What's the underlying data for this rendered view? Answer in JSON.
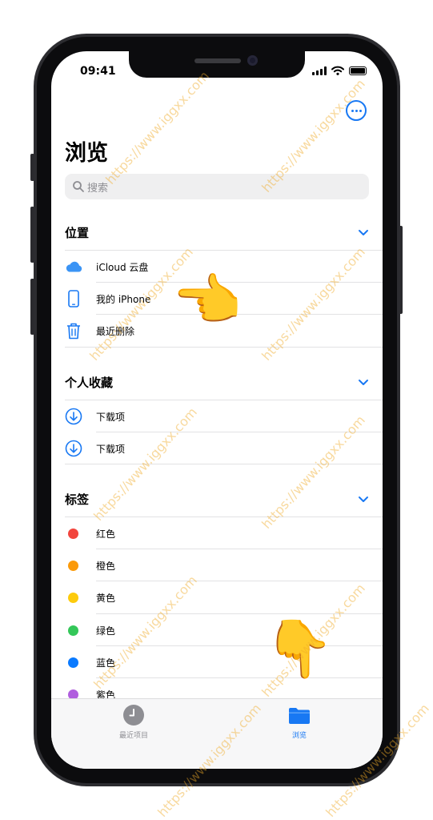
{
  "status_bar": {
    "time": "09:41"
  },
  "page": {
    "title": "浏览",
    "more_icon": "ellipsis-circle-icon"
  },
  "search": {
    "placeholder": "搜索"
  },
  "sections": {
    "locations": {
      "title": "位置",
      "items": [
        {
          "label": "iCloud 云盘",
          "icon": "icloud-icon"
        },
        {
          "label": "我的 iPhone",
          "icon": "iphone-icon"
        },
        {
          "label": "最近删除",
          "icon": "trash-icon"
        }
      ]
    },
    "favorites": {
      "title": "个人收藏",
      "items": [
        {
          "label": "下载项",
          "icon": "download-icon"
        },
        {
          "label": "下载项",
          "icon": "download-icon"
        }
      ]
    },
    "tags": {
      "title": "标签",
      "items": [
        {
          "label": "红色",
          "color": "#f2453d"
        },
        {
          "label": "橙色",
          "color": "#fb9a0a"
        },
        {
          "label": "黄色",
          "color": "#fdcb0c"
        },
        {
          "label": "绿色",
          "color": "#34c759"
        },
        {
          "label": "蓝色",
          "color": "#0a7aff"
        },
        {
          "label": "紫色",
          "color": "#b05ede"
        }
      ]
    }
  },
  "tabbar": {
    "recents": {
      "label": "最近项目",
      "icon": "clock-icon"
    },
    "browse": {
      "label": "浏览",
      "icon": "folder-icon"
    }
  },
  "colors": {
    "accent": "#1878f3",
    "inactive": "#8e8e93"
  },
  "watermark": "https://www.iggxx.com"
}
